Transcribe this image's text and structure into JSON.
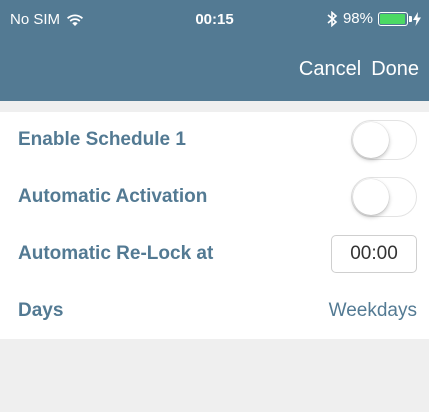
{
  "status_bar": {
    "carrier": "No SIM",
    "time": "00:15",
    "battery_percent": "98%",
    "battery_level": 0.98,
    "icons": [
      "wifi-icon",
      "bluetooth-icon",
      "battery-icon",
      "charging-bolt-icon"
    ]
  },
  "nav": {
    "cancel_label": "Cancel",
    "done_label": "Done"
  },
  "settings": {
    "enable_schedule": {
      "label": "Enable Schedule 1",
      "on": false
    },
    "automatic_activation": {
      "label": "Automatic Activation",
      "on": false
    },
    "relock": {
      "label": "Automatic Re-Lock at",
      "value": "00:00"
    },
    "days": {
      "label": "Days",
      "value": "Weekdays"
    }
  },
  "colors": {
    "header": "#537a93",
    "accent_text": "#537a93",
    "background": "#efefef",
    "battery_fill": "#4cd964"
  }
}
